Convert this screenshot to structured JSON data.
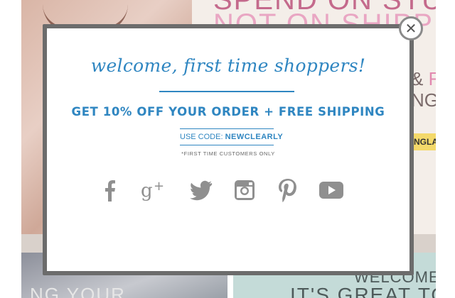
{
  "background": {
    "headline_line1": "SPEND ON STUFF",
    "headline_line2": "NOT ON SHIPP",
    "side_line1": "&",
    "side_line1_pink": "F",
    "side_line2": "NGL",
    "yellow_tag": "NGLAS",
    "bottom_left_text": "NG YOUR",
    "bottom_right_line1": "WELCOME",
    "bottom_right_line2": "IT'S GREAT TO S"
  },
  "modal": {
    "title": "welcome, first time shoppers!",
    "offer": "GET 10% OFF YOUR ORDER + FREE SHIPPING",
    "code_prefix": "USE CODE: ",
    "code": "NEWCLEARLY",
    "fine_print": "*FIRST TIME CUSTOMERS ONLY",
    "close_glyph": "✕",
    "social": [
      {
        "name": "facebook"
      },
      {
        "name": "google-plus"
      },
      {
        "name": "twitter"
      },
      {
        "name": "instagram"
      },
      {
        "name": "pinterest"
      },
      {
        "name": "youtube"
      }
    ]
  },
  "colors": {
    "accent": "#2f86c1",
    "icon_gray": "#8f8f8f",
    "frame": "#6c6c6c"
  }
}
